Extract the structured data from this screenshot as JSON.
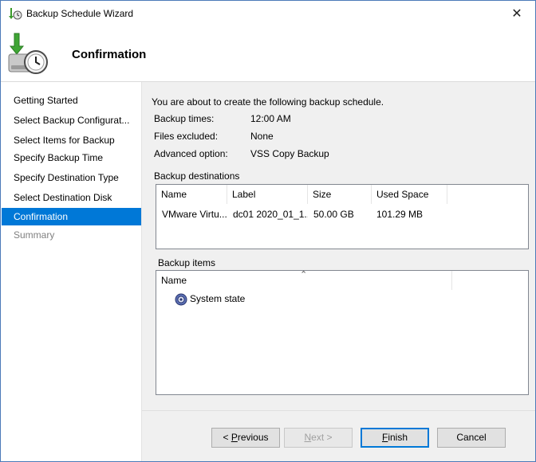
{
  "window": {
    "title": "Backup Schedule Wizard",
    "close_glyph": "✕"
  },
  "header": {
    "title": "Confirmation"
  },
  "nav": {
    "items": [
      {
        "label": "Getting Started",
        "state": "normal"
      },
      {
        "label": "Select Backup Configurat...",
        "state": "normal"
      },
      {
        "label": "Select Items for Backup",
        "state": "normal"
      },
      {
        "label": "Specify Backup Time",
        "state": "normal"
      },
      {
        "label": "Specify Destination Type",
        "state": "normal"
      },
      {
        "label": "Select Destination Disk",
        "state": "normal"
      },
      {
        "label": "Confirmation",
        "state": "active"
      },
      {
        "label": "Summary",
        "state": "disabled"
      }
    ]
  },
  "content": {
    "intro": "You are about to create the following backup schedule.",
    "details": [
      {
        "label": "Backup times:",
        "value": "12:00 AM"
      },
      {
        "label": "Files excluded:",
        "value": "None"
      },
      {
        "label": "Advanced option:",
        "value": "VSS Copy Backup"
      }
    ],
    "destinations": {
      "heading": "Backup destinations",
      "columns": [
        "Name",
        "Label",
        "Size",
        "Used Space"
      ],
      "rows": [
        [
          "VMware Virtu...",
          "dc01 2020_01_1...",
          "50.00 GB",
          "101.29 MB"
        ]
      ]
    },
    "items": {
      "heading": "Backup items",
      "column": "Name",
      "sort_glyph": "⌃",
      "rows": [
        {
          "label": "System state",
          "icon": "system-state-icon"
        }
      ]
    }
  },
  "buttons": {
    "previous_prefix": "< ",
    "previous_accel": "P",
    "previous_rest": "revious",
    "next_prefix": "",
    "next_accel": "N",
    "next_rest": "ext >",
    "finish_accel": "F",
    "finish_rest": "inish",
    "cancel": "Cancel"
  },
  "colors": {
    "accent": "#0078d7",
    "window_border": "#4c7ab8"
  }
}
